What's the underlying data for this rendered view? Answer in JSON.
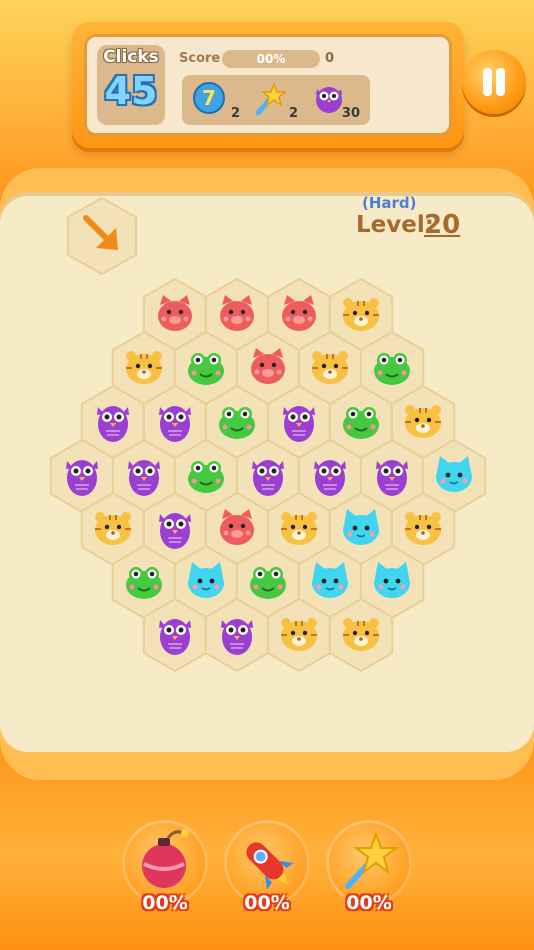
{
  "header": {
    "clicks_label": "Clicks",
    "clicks_value": "45",
    "score_label": "Score",
    "score_progress_text": "00%",
    "score_value": "0"
  },
  "boosters": [
    {
      "name": "color-ball-icon",
      "glyph": "7",
      "count": "2"
    },
    {
      "name": "magic-wand-icon",
      "glyph": "",
      "count": "2"
    },
    {
      "name": "owl-target-icon",
      "glyph": "",
      "count": "30"
    }
  ],
  "level": {
    "difficulty": "(Hard)",
    "label": "Level:",
    "value": "20"
  },
  "colors": {
    "pig": "#ee5d5d",
    "frog": "#46c840",
    "owl": "#9a3fd1",
    "tiger": "#f9c144",
    "cat": "#40d6f0"
  },
  "board": [
    {
      "animal": "pig"
    },
    {
      "animal": "pig"
    },
    {
      "animal": "pig"
    },
    {
      "animal": "tiger"
    },
    {
      "animal": "tiger"
    },
    {
      "animal": "frog"
    },
    {
      "animal": "pig"
    },
    {
      "animal": "tiger"
    },
    {
      "animal": "frog"
    },
    {
      "animal": "owl"
    },
    {
      "animal": "owl"
    },
    {
      "animal": "frog"
    },
    {
      "animal": "owl"
    },
    {
      "animal": "frog"
    },
    {
      "animal": "tiger"
    },
    {
      "animal": "owl"
    },
    {
      "animal": "owl"
    },
    {
      "animal": "frog"
    },
    {
      "animal": "owl"
    },
    {
      "animal": "owl"
    },
    {
      "animal": "owl"
    },
    {
      "animal": "cat"
    },
    {
      "animal": "tiger"
    },
    {
      "animal": "owl"
    },
    {
      "animal": "pig"
    },
    {
      "animal": "tiger"
    },
    {
      "animal": "cat"
    },
    {
      "animal": "tiger"
    },
    {
      "animal": "frog"
    },
    {
      "animal": "cat"
    },
    {
      "animal": "frog"
    },
    {
      "animal": "cat"
    },
    {
      "animal": "cat"
    },
    {
      "animal": "owl"
    },
    {
      "animal": "owl"
    },
    {
      "animal": "tiger"
    },
    {
      "animal": "tiger"
    }
  ],
  "powerups": [
    {
      "name": "bomb-icon",
      "percent": "00%"
    },
    {
      "name": "rocket-icon",
      "percent": "00%"
    },
    {
      "name": "star-wand-icon",
      "percent": "00%"
    }
  ]
}
